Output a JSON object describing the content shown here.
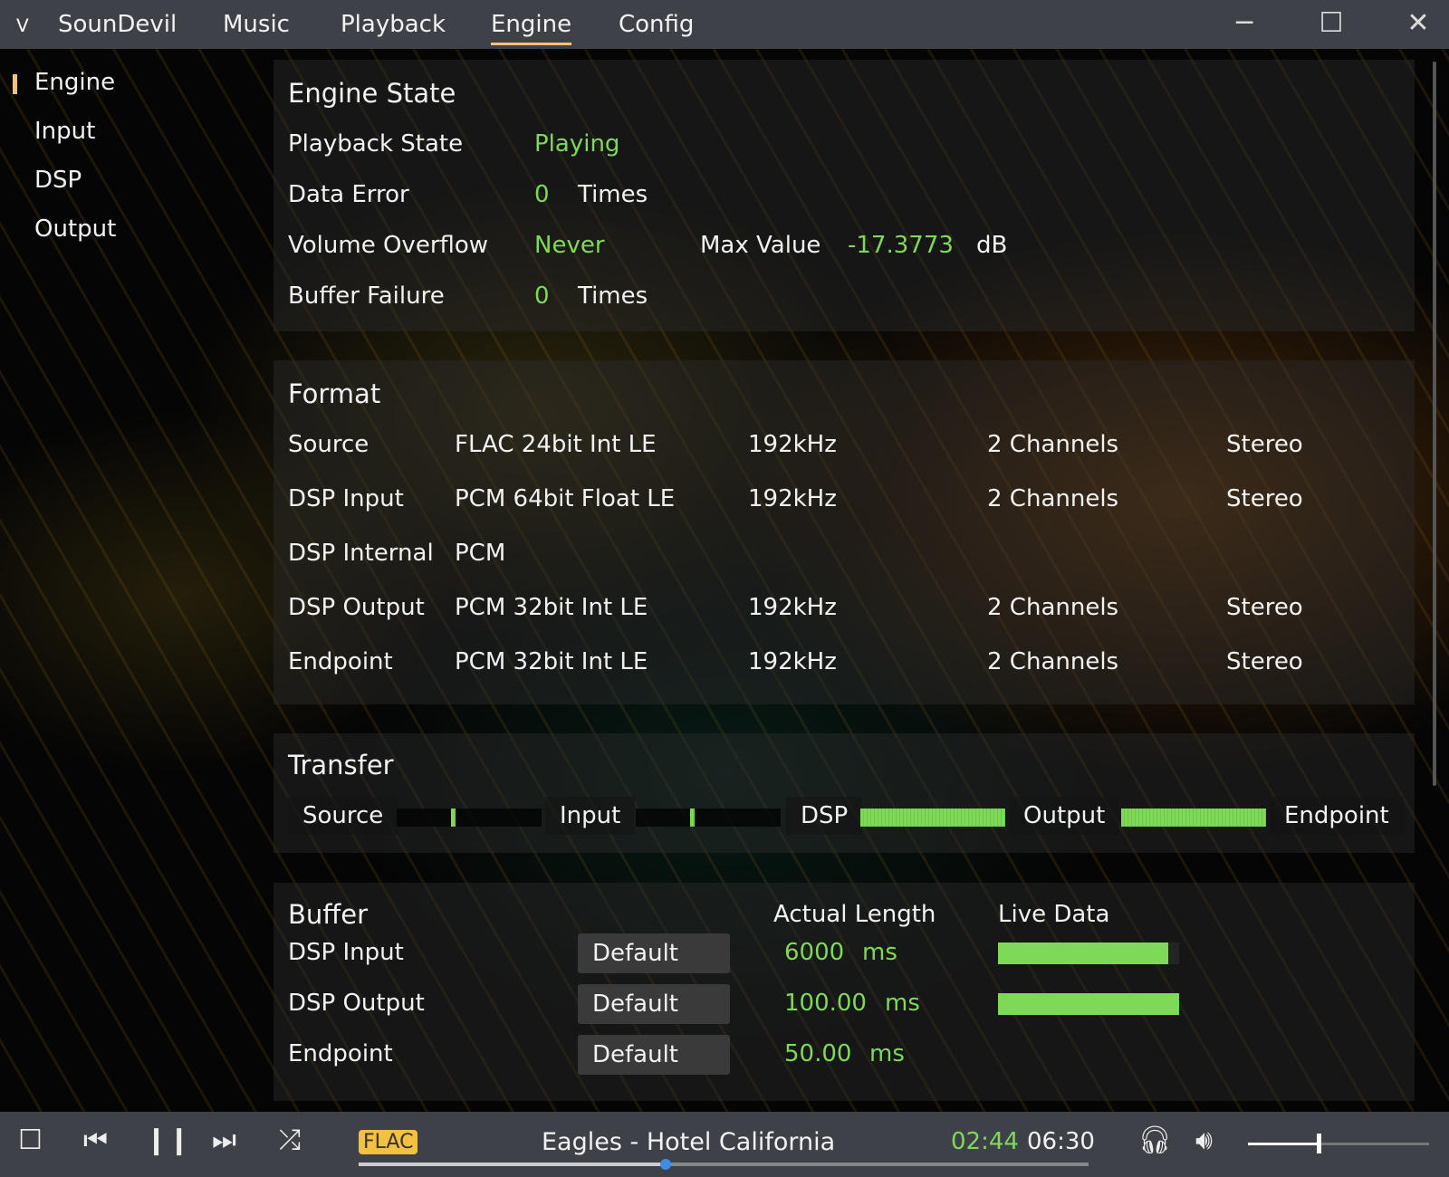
{
  "app": {
    "name": "SounDevil"
  },
  "menu": [
    "Music",
    "Playback",
    "Engine",
    "Config"
  ],
  "sidebar": [
    "Engine",
    "Input",
    "DSP",
    "Output"
  ],
  "engine_state": {
    "title": "Engine State",
    "playback_label": "Playback State",
    "playback_value": "Playing",
    "data_error_label": "Data Error",
    "data_error_value": "0",
    "data_error_unit": "Times",
    "overflow_label": "Volume Overflow",
    "overflow_value": "Never",
    "max_label": "Max Value",
    "max_value": "-17.3773",
    "max_unit": "dB",
    "buffer_failure_label": "Buffer Failure",
    "buffer_failure_value": "0",
    "buffer_failure_unit": "Times"
  },
  "format": {
    "title": "Format",
    "rows": [
      [
        "Source",
        "FLAC 24bit Int LE",
        "192kHz",
        "2 Channels",
        "Stereo"
      ],
      [
        "DSP Input",
        "PCM 64bit Float LE",
        "192kHz",
        "2 Channels",
        "Stereo"
      ],
      [
        "DSP Internal",
        "PCM",
        "",
        "",
        ""
      ],
      [
        "DSP Output",
        "PCM 32bit Int LE",
        "192kHz",
        "2 Channels",
        "Stereo"
      ],
      [
        "Endpoint",
        "PCM 32bit Int LE",
        "192kHz",
        "2 Channels",
        "Stereo"
      ]
    ]
  },
  "transfer": {
    "title": "Transfer",
    "stages": [
      "Source",
      "Input",
      "DSP",
      "Output",
      "Endpoint"
    ],
    "levels_percent": [
      5,
      3,
      100,
      100
    ]
  },
  "buffer": {
    "title": "Buffer",
    "actual_length_header": "Actual Length",
    "live_data_header": "Live Data",
    "rows": [
      {
        "label": "DSP Input",
        "mode": "Default",
        "length": "6000",
        "unit": "ms",
        "live_percent": 94
      },
      {
        "label": "DSP Output",
        "mode": "Default",
        "length": "100.00",
        "unit": "ms",
        "live_percent": 100
      },
      {
        "label": "Endpoint",
        "mode": "Default",
        "length": "50.00",
        "unit": "ms",
        "live_percent": 0
      }
    ]
  },
  "player": {
    "format_badge": "FLAC",
    "track": "Eagles - Hotel California",
    "elapsed": "02:44",
    "duration": "06:30",
    "progress_percent": 42,
    "volume_percent": 39
  },
  "colors": {
    "accent": "#f4c27a",
    "green": "#7ed957",
    "titlebar": "#3f4148"
  }
}
